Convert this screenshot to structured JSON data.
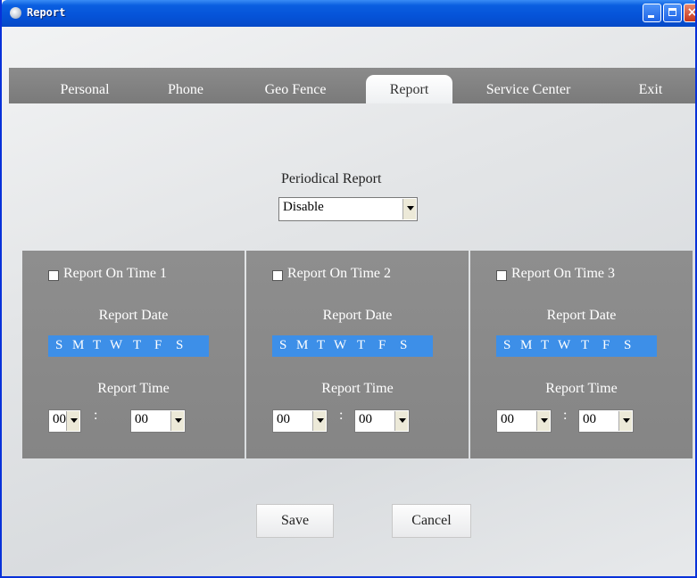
{
  "window": {
    "title": "Report",
    "close_glyph": "×"
  },
  "tabs": [
    {
      "label": "Personal"
    },
    {
      "label": "Phone"
    },
    {
      "label": "Geo Fence"
    },
    {
      "label": "Report",
      "active": true
    },
    {
      "label": "Service Center"
    },
    {
      "label": "Exit"
    }
  ],
  "periodical": {
    "label": "Periodical Report",
    "value": "Disable"
  },
  "panels": [
    {
      "checkbox_label": "Report On Time 1",
      "checked": false,
      "date_label": "Report Date",
      "time_label": "Report Time",
      "hour": "00",
      "minute": "00"
    },
    {
      "checkbox_label": "Report On Time 2",
      "checked": false,
      "date_label": "Report Date",
      "time_label": "Report Time",
      "hour": "00",
      "minute": "00"
    },
    {
      "checkbox_label": "Report On Time 3",
      "checked": false,
      "date_label": "Report Date",
      "time_label": "Report Time",
      "hour": "00",
      "minute": "00"
    }
  ],
  "weekdays": [
    "S",
    "M",
    "T",
    "W",
    "T",
    "F",
    "S"
  ],
  "time_separator": ":",
  "buttons": {
    "save": "Save",
    "cancel": "Cancel"
  },
  "colors": {
    "title_bar": "#0553d8",
    "tab_bar": "#808080",
    "panel": "#8a8a8a",
    "day_strip": "#3d8fe8"
  },
  "icons": [
    "app-icon",
    "minimize-icon",
    "maximize-icon",
    "close-icon",
    "dropdown-arrow-icon"
  ]
}
